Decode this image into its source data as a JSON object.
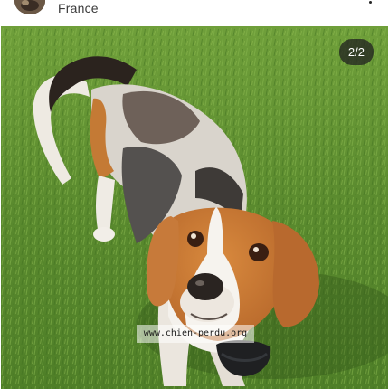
{
  "post": {
    "location": "France",
    "more_icon": "more-vertical-icon"
  },
  "carousel": {
    "counter": "2/2"
  },
  "photo": {
    "subject": "beagle",
    "watermark": "www.chien-perdu.org"
  },
  "colors": {
    "badge_bg": "#202020",
    "grass": "#5f8d33"
  }
}
